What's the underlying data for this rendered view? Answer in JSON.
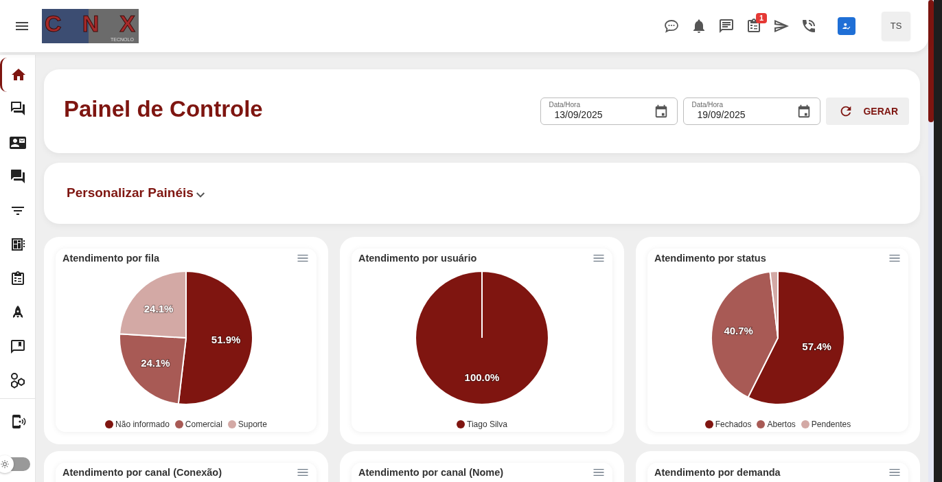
{
  "header": {
    "logo": {
      "text": "CNX",
      "subtext": "TECNOLO"
    },
    "icons": [
      {
        "kind": "chat"
      },
      {
        "kind": "bell"
      },
      {
        "kind": "message"
      },
      {
        "kind": "tasks",
        "badge": "1"
      },
      {
        "kind": "send"
      },
      {
        "kind": "phone"
      },
      {
        "kind": "user-check"
      }
    ],
    "avatar": "TS"
  },
  "sidebar": {
    "items": [
      {
        "selected": true
      },
      {
        "selected": false
      },
      {
        "selected": false
      },
      {
        "selected": false
      },
      {
        "selected": false
      },
      {
        "selected": false
      },
      {
        "selected": false
      },
      {
        "selected": false
      },
      {
        "selected": false
      },
      {
        "selected": false
      },
      {
        "selected": false
      }
    ],
    "dark_mode": false
  },
  "title_card": {
    "title": "Painel de Controle",
    "date_fields": [
      {
        "label": "Data/Hora",
        "value": "13/09/2025"
      },
      {
        "label": "Data/Hora",
        "value": "19/09/2025"
      }
    ],
    "button": "GERAR"
  },
  "customize": {
    "label": "Personalizar Painéis",
    "expanded": false
  },
  "charts": [
    {
      "title": "Atendimento por fila",
      "chart_data": {
        "type": "pie",
        "categories": [
          "Não informado",
          "Comercial",
          "Suporte"
        ],
        "values": [
          51.9,
          24.1,
          24.1
        ],
        "colors": [
          "#7f1510",
          "#a85a55",
          "#d3a9a5"
        ],
        "value_labels": [
          "51.9%",
          "24.1%",
          "24.1%"
        ]
      }
    },
    {
      "title": "Atendimento por usuário",
      "chart_data": {
        "type": "pie",
        "categories": [
          "Tiago Silva"
        ],
        "values": [
          100
        ],
        "colors": [
          "#7f1510"
        ],
        "value_labels": [
          "100.0%"
        ]
      }
    },
    {
      "title": "Atendimento por status",
      "chart_data": {
        "type": "pie",
        "categories": [
          "Fechados",
          "Abertos",
          "Pendentes"
        ],
        "values": [
          57.4,
          40.7,
          1.9
        ],
        "colors": [
          "#7f1510",
          "#a85a55",
          "#d3a9a5"
        ],
        "value_labels": [
          "57.4%",
          "40.7%",
          null
        ]
      }
    },
    {
      "title": "Atendimento por canal (Conexão)"
    },
    {
      "title": "Atendimento por canal (Nome)"
    },
    {
      "title": "Atendimento por demanda"
    }
  ]
}
